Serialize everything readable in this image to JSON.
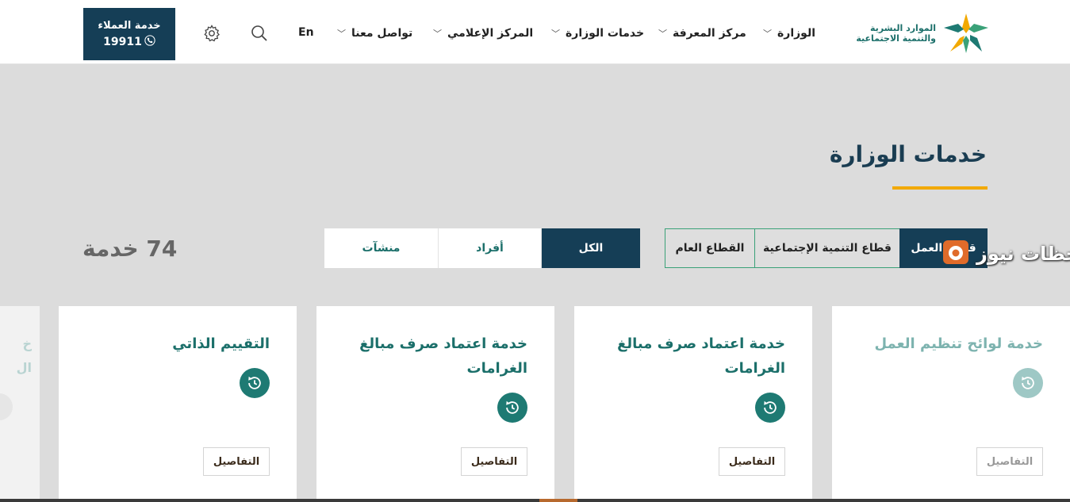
{
  "header": {
    "logo_line1": "الموارد البشرية",
    "logo_line2": "والتنمية الاجتماعية",
    "nav": [
      {
        "label": "الوزارة",
        "has_menu": true
      },
      {
        "label": "مركز المعرفة",
        "has_menu": true
      },
      {
        "label": "خدمات الوزارة",
        "has_menu": true
      },
      {
        "label": "المركز الإعلامي",
        "has_menu": true
      },
      {
        "label": "تواصل معنا",
        "has_menu": true
      }
    ],
    "lang_label": "En",
    "search_icon": "search-icon",
    "settings_icon": "gear-icon",
    "customer_service": {
      "label": "خدمة العملاء",
      "number": "19911",
      "icon": "phone-icon"
    }
  },
  "main": {
    "title": "خدمات الوزارة",
    "sector_tabs": [
      {
        "label": "قطاع العمل",
        "active": true
      },
      {
        "label": "قطاع التنمية الإجتماعية",
        "active": false
      },
      {
        "label": "القطاع العام",
        "active": false
      }
    ],
    "audience_tabs": [
      {
        "label": "الكل",
        "active": true
      },
      {
        "label": "أفراد",
        "active": false
      },
      {
        "label": "منشآت",
        "active": false
      }
    ],
    "service_count": "74 خدمة",
    "cards": [
      {
        "title": "خدمة لوائح تنظيم العمل",
        "button": "التفاصيل",
        "icon": "clock-history-icon"
      },
      {
        "title": "خدمة اعتماد صرف مبالغ الغرامات",
        "button": "التفاصيل",
        "icon": "clock-history-icon"
      },
      {
        "title": "خدمة اعتماد صرف مبالغ الغرامات",
        "button": "التفاصيل",
        "icon": "clock-history-icon"
      },
      {
        "title": "التقييم الذاتي",
        "button": "التفاصيل",
        "icon": "clock-history-icon"
      }
    ],
    "edge_card_text": [
      "خ",
      "ال"
    ]
  },
  "watermark": {
    "text": "لحظات نيوز"
  },
  "colors": {
    "primary": "#153e56",
    "accent": "#f2a900",
    "teal": "#1e7a73",
    "tab_border": "#3aa178"
  }
}
